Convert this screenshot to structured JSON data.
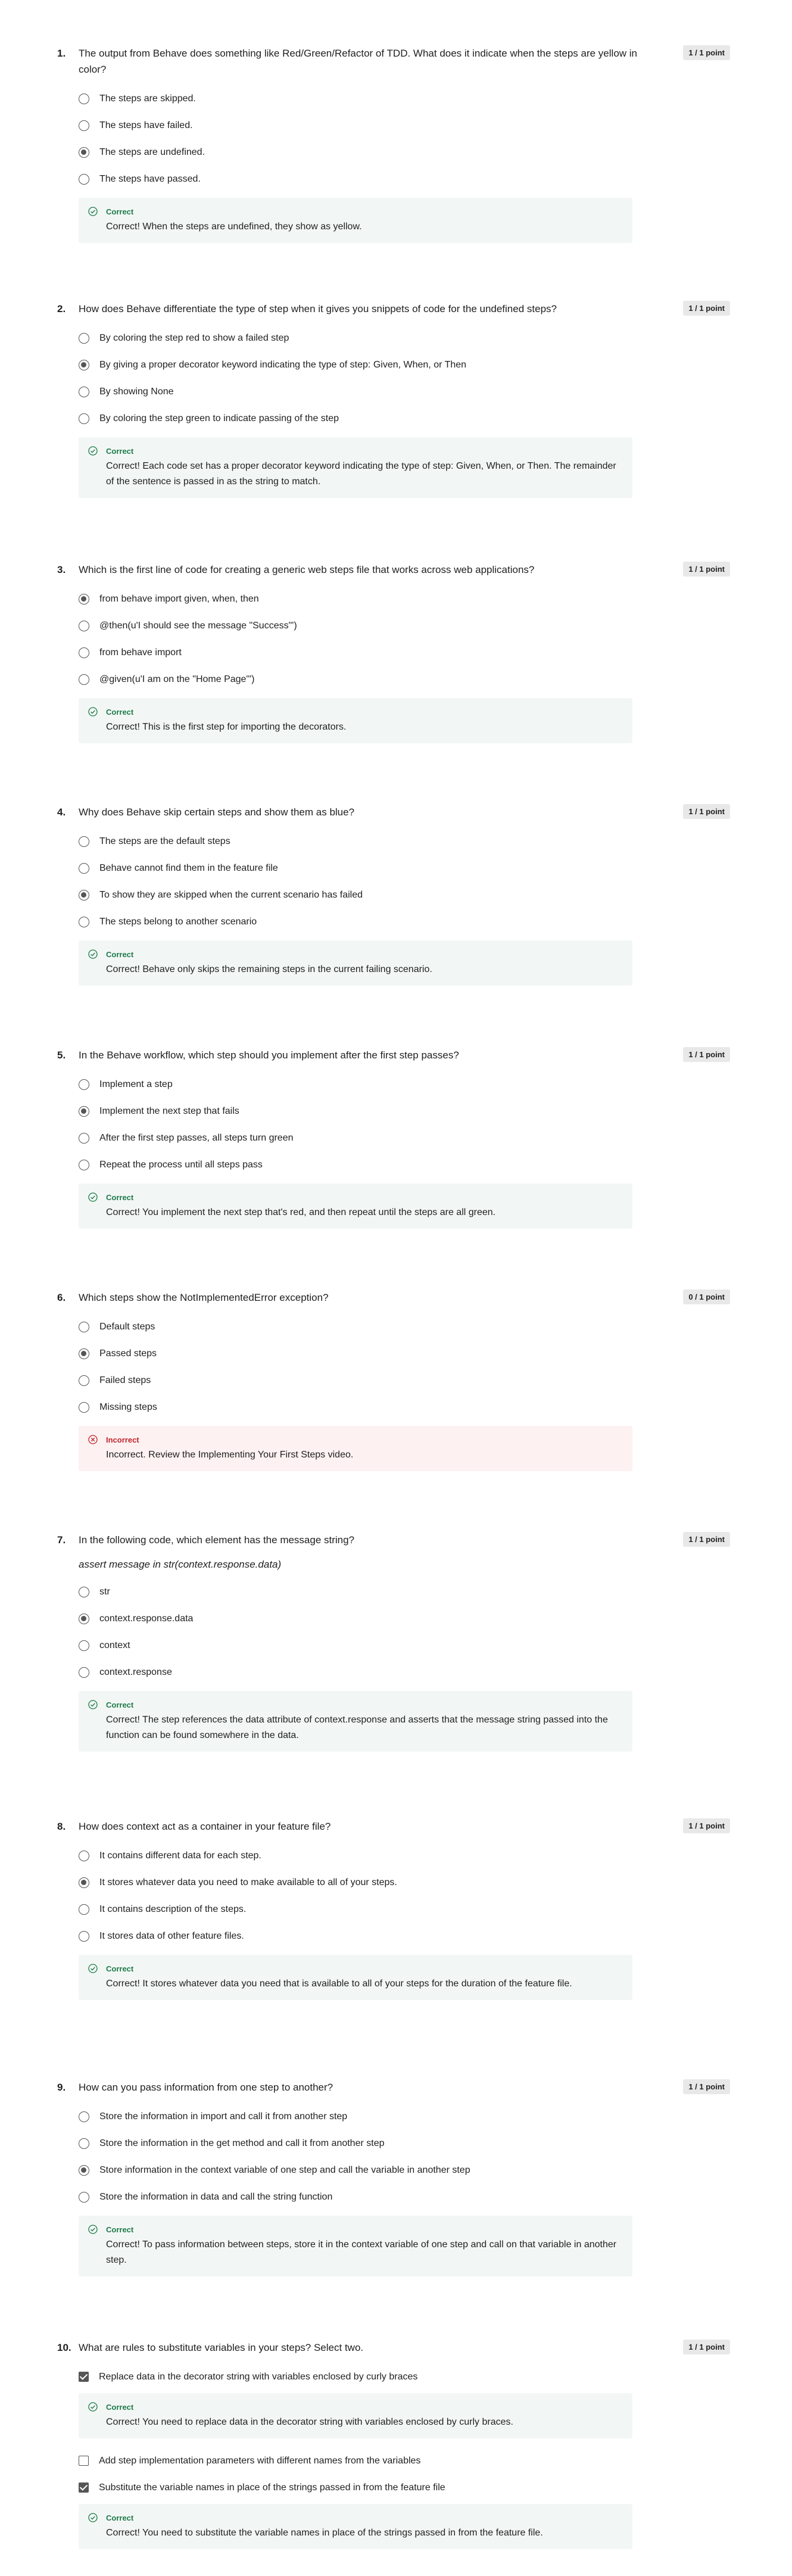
{
  "questions": [
    {
      "num": "1.",
      "text": "The output from Behave does something like Red/Green/Refactor of TDD. What does it indicate when the steps are yellow in color?",
      "points": "1 / 1 point",
      "options": [
        "The steps are skipped.",
        "The steps have failed.",
        "The steps are undefined.",
        "The steps have passed."
      ],
      "selected": 2,
      "feedback": {
        "status": "Correct",
        "text": "Correct! When the steps are undefined, they show as yellow."
      }
    },
    {
      "num": "2.",
      "text": "How does Behave differentiate the type of step when it gives you snippets of code for the undefined steps?",
      "points": "1 / 1 point",
      "options": [
        "By coloring the step red to show a failed step",
        "By giving a proper decorator keyword indicating the type of step: Given, When, or Then",
        "By showing None",
        "By coloring the step green to indicate passing of the step"
      ],
      "selected": 1,
      "feedback": {
        "status": "Correct",
        "text": "Correct! Each code set has a proper decorator keyword indicating the type of step: Given, When, or Then. The remainder of the sentence is passed in as the string to match."
      }
    },
    {
      "num": "3.",
      "text": "Which is the first line of code for creating a generic web steps file that works across web applications?",
      "points": "1 / 1 point",
      "options": [
        "from behave import given, when, then",
        "@then(u'I should see the message \"Success\"')",
        "from behave import",
        "@given(u'I am on the \"Home Page\"')"
      ],
      "selected": 0,
      "feedback": {
        "status": "Correct",
        "text": "Correct! This is the first step for importing the decorators."
      }
    },
    {
      "num": "4.",
      "text": "Why does Behave skip certain steps and show them as blue?",
      "points": "1 / 1 point",
      "options": [
        "The steps are the default steps",
        "Behave cannot find them in the feature file",
        "To show they are skipped when the current scenario has failed",
        "The steps belong to another scenario"
      ],
      "selected": 2,
      "feedback": {
        "status": "Correct",
        "text": "Correct! Behave only skips the remaining steps in the current failing scenario."
      }
    },
    {
      "num": "5.",
      "text": "In the Behave workflow, which step should you implement after the first step passes?",
      "points": "1 / 1 point",
      "options": [
        "Implement a step",
        "Implement the next step that fails",
        "After the first step passes, all steps turn green",
        "Repeat the process until all steps pass"
      ],
      "selected": 1,
      "feedback": {
        "status": "Correct",
        "text": "Correct! You implement the next step that's red, and then repeat until the steps are all green."
      }
    },
    {
      "num": "6.",
      "text": "Which steps show the NotImplementedError exception?",
      "points": "0 / 1 point",
      "options": [
        "Default steps",
        "Passed steps",
        "Failed steps",
        "Missing steps"
      ],
      "selected": 1,
      "feedback": {
        "status": "Incorrect",
        "text": "Incorrect. Review the Implementing Your First Steps video."
      }
    },
    {
      "num": "7.",
      "text": "In the following code, which element has the message string?",
      "code": "assert message in str(context.response.data)",
      "points": "1 / 1 point",
      "options": [
        "str",
        "context.response.data",
        "context",
        "context.response"
      ],
      "selected": 1,
      "feedback": {
        "status": "Correct",
        "text": "Correct! The step references the data attribute of context.response and asserts that the message string passed into the function can be found somewhere in the data."
      }
    },
    {
      "num": "8.",
      "text": "How does context act as a container in your feature file?",
      "points": "1 / 1 point",
      "options": [
        "It contains different data for each step.",
        "It stores whatever data you need to make available to all of your steps.",
        "It contains description of the steps.",
        "It stores data of other feature files."
      ],
      "selected": 1,
      "feedback": {
        "status": "Correct",
        "text": "Correct! It stores whatever data you need that is available to all of your steps for the duration of the feature file."
      }
    },
    {
      "num": "9.",
      "text": "How can you pass information from one step to another?",
      "points": "1 / 1 point",
      "options": [
        "Store the information in import and call it from another step",
        "Store the information in the get method and call it from another step",
        "Store information in the context variable of one step and call the variable in another step",
        "Store the information in data and call the string function"
      ],
      "selected": 2,
      "feedback": {
        "status": "Correct",
        "text": "Correct! To pass information between steps, store it in the context variable of one step and call on that variable in another step."
      }
    },
    {
      "num": "10.",
      "text": "What are rules to substitute variables in your steps? Select two.",
      "points": "1 / 1 point",
      "check_items": [
        {
          "label": "Replace data in the decorator string with variables enclosed by curly braces",
          "checked": true,
          "feedback": {
            "status": "Correct",
            "text": "Correct! You need to replace data in the decorator string with variables enclosed by curly braces."
          }
        },
        {
          "label": "Add step implementation parameters with different names from the variables",
          "checked": false
        },
        {
          "label": "Substitute the variable names in place of the strings passed in from the feature file",
          "checked": true,
          "feedback": {
            "status": "Correct",
            "text": "Correct! You need to substitute the variable names in place of the strings passed in from the feature file."
          }
        }
      ]
    }
  ]
}
